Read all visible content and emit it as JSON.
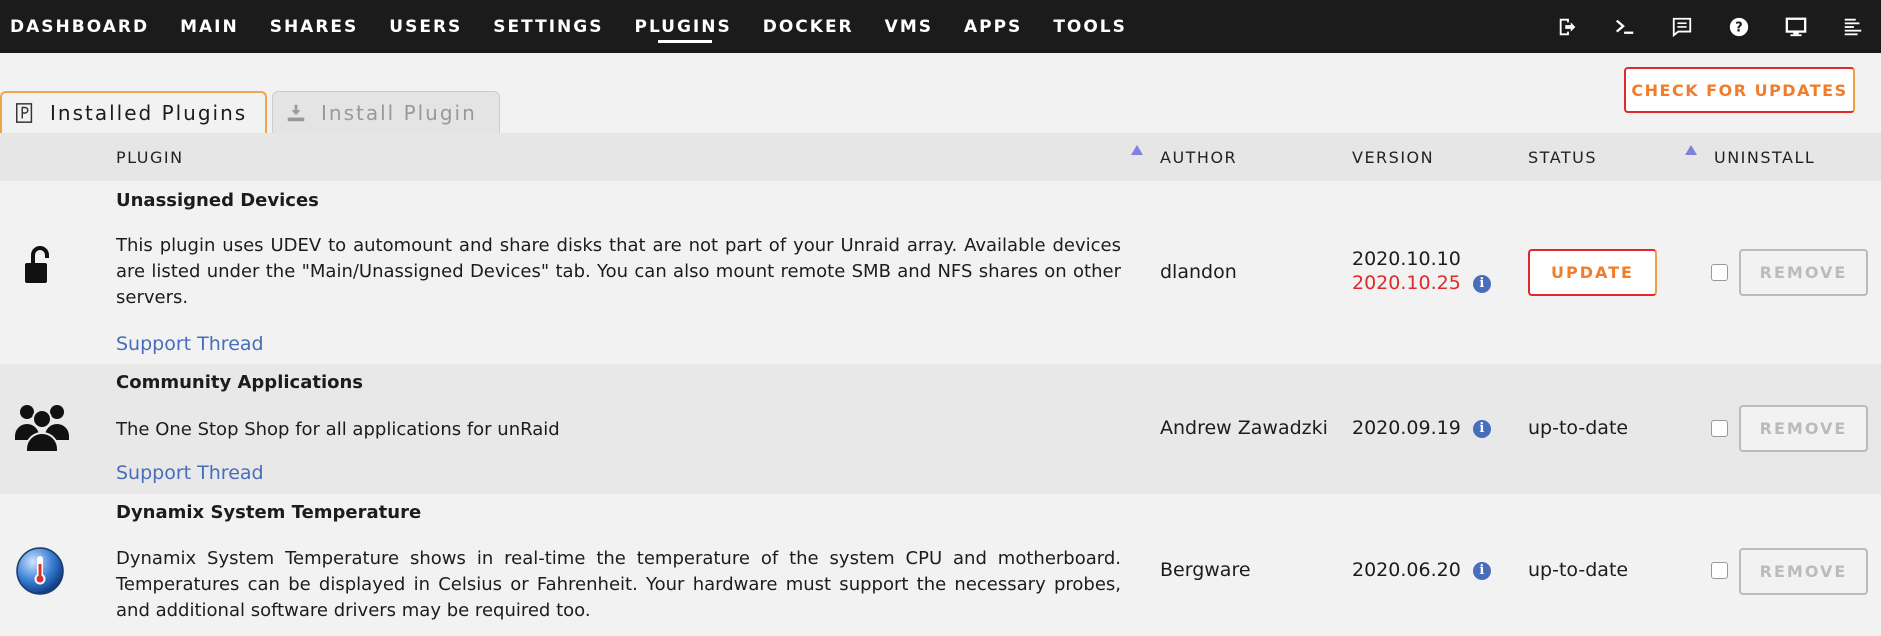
{
  "nav": {
    "items": [
      "DASHBOARD",
      "MAIN",
      "SHARES",
      "USERS",
      "SETTINGS",
      "PLUGINS",
      "DOCKER",
      "VMS",
      "APPS",
      "TOOLS"
    ],
    "active": "PLUGINS",
    "icons": [
      "logout-icon",
      "terminal-icon",
      "feedback-icon",
      "help-icon",
      "monitor-icon",
      "log-icon"
    ]
  },
  "tabs": {
    "installed": "Installed Plugins",
    "install": "Install Plugin"
  },
  "check_updates": "CHECK FOR UPDATES",
  "table": {
    "headers": {
      "plugin": "PLUGIN",
      "author": "AUTHOR",
      "version": "VERSION",
      "status": "STATUS",
      "uninstall": "UNINSTALL"
    },
    "rows": [
      {
        "name": "Unassigned Devices",
        "description": "This plugin uses UDEV to automount and share disks that are not part of your Unraid array. Available devices are listed under the \"Main/Unassigned Devices\" tab. You can also mount remote SMB and NFS shares on other servers.",
        "support": "Support Thread",
        "author": "dlandon",
        "version": "2020.10.10",
        "new_version": "2020.10.25",
        "status": "UPDATE",
        "remove": "REMOVE",
        "icon": "unlock-icon"
      },
      {
        "name": "Community Applications",
        "description": "The One Stop Shop for all applications for unRaid",
        "support": "Support Thread",
        "author": "Andrew Zawadzki",
        "version": "2020.09.19",
        "status": "up-to-date",
        "remove": "REMOVE",
        "icon": "users-icon"
      },
      {
        "name": "Dynamix System Temperature",
        "description": "Dynamix System Temperature shows in real-time the temperature of the system CPU and motherboard. Temperatures can be displayed in Celsius or Fahrenheit. Your hardware must support the necessary probes, and additional software drivers may be required too.",
        "author": "Bergware",
        "version": "2020.06.20",
        "status": "up-to-date",
        "remove": "REMOVE",
        "icon": "thermometer-icon"
      }
    ]
  }
}
